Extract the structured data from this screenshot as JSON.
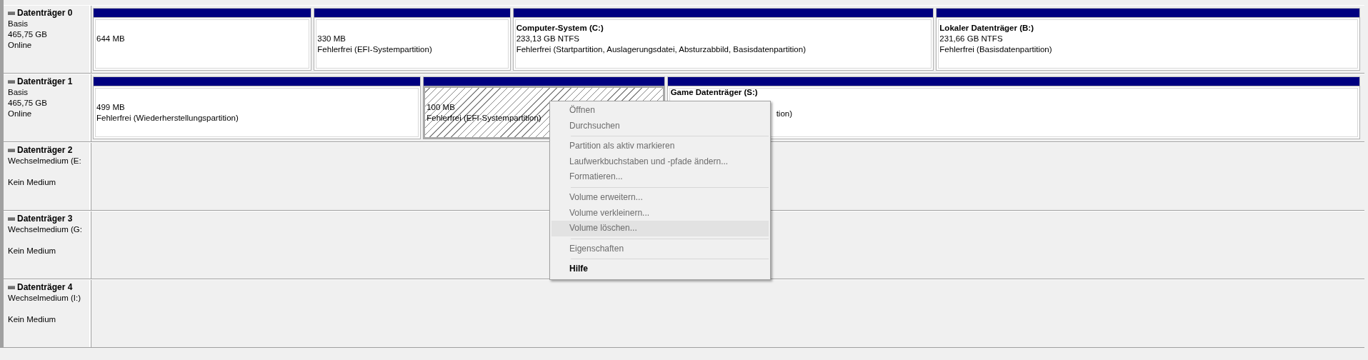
{
  "disks": [
    {
      "name": "Datenträger 0",
      "type": "Basis",
      "size": "465,75 GB",
      "status": "Online",
      "partitions": [
        {
          "size": "644 MB",
          "selected": false
        },
        {
          "size": "330 MB",
          "status": "Fehlerfrei (EFI-Systempartition)",
          "selected": false
        },
        {
          "name": "Computer-System  (C:)",
          "size": "233,13 GB NTFS",
          "status": "Fehlerfrei (Startpartition, Auslagerungsdatei, Absturzabbild, Basisdatenpartition)",
          "selected": false
        },
        {
          "name": "Lokaler Datenträger  (B:)",
          "size": "231,66 GB NTFS",
          "status": "Fehlerfrei (Basisdatenpartition)",
          "selected": false
        }
      ]
    },
    {
      "name": "Datenträger 1",
      "type": "Basis",
      "size": "465,75 GB",
      "status": "Online",
      "partitions": [
        {
          "size": "499 MB",
          "status": "Fehlerfrei (Wiederherstellungspartition)",
          "selected": false
        },
        {
          "size": "100 MB",
          "status": "Fehlerfrei (EFI-Systempartition)",
          "selected": true
        },
        {
          "name": "Game Datenträger  (S:)",
          "status": "tion)",
          "selected": false,
          "covered": true
        }
      ]
    },
    {
      "name": "Datenträger 2",
      "type": "Wechselmedium (E:",
      "status": "Kein Medium"
    },
    {
      "name": "Datenträger 3",
      "type": "Wechselmedium (G:",
      "status": "Kein Medium"
    },
    {
      "name": "Datenträger 4",
      "type": "Wechselmedium (I:)",
      "status": "Kein Medium"
    }
  ],
  "context_menu": {
    "items": [
      {
        "kind": "item",
        "label": "Öffnen",
        "disabled": true,
        "selected": false,
        "default": false
      },
      {
        "kind": "item",
        "label": "Durchsuchen",
        "disabled": true,
        "selected": false,
        "default": false
      },
      {
        "kind": "separator"
      },
      {
        "kind": "item",
        "label": "Partition als aktiv markieren",
        "disabled": true,
        "selected": false,
        "default": false
      },
      {
        "kind": "item",
        "label": "Laufwerkbuchstaben und -pfade ändern...",
        "disabled": true,
        "selected": false,
        "default": false
      },
      {
        "kind": "item",
        "label": "Formatieren...",
        "disabled": true,
        "selected": false,
        "default": false
      },
      {
        "kind": "separator"
      },
      {
        "kind": "item",
        "label": "Volume erweitern...",
        "disabled": true,
        "selected": false,
        "default": false
      },
      {
        "kind": "item",
        "label": "Volume verkleinern...",
        "disabled": true,
        "selected": false,
        "default": false
      },
      {
        "kind": "item",
        "label": "Volume löschen...",
        "disabled": true,
        "selected": true,
        "default": false
      },
      {
        "kind": "separator"
      },
      {
        "kind": "item",
        "label": "Eigenschaften",
        "disabled": true,
        "selected": false,
        "default": false
      },
      {
        "kind": "separator"
      },
      {
        "kind": "item",
        "label": "Hilfe",
        "disabled": false,
        "selected": false,
        "default": true
      }
    ]
  }
}
